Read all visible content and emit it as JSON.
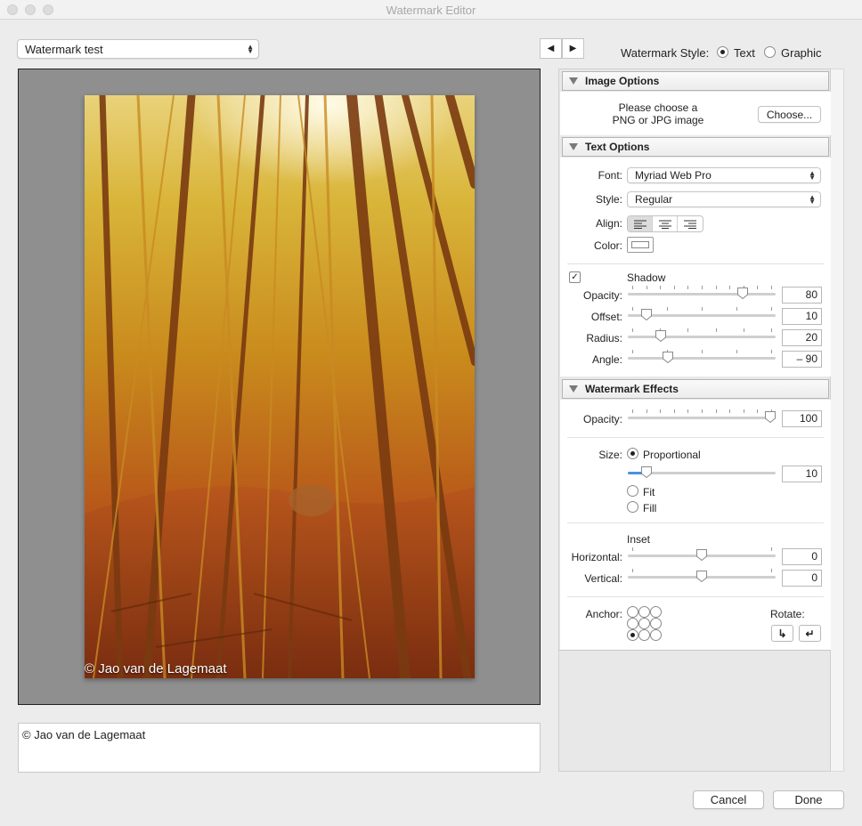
{
  "window": {
    "title": "Watermark Editor"
  },
  "preset": {
    "value": "Watermark test"
  },
  "nav": {
    "prev": "◀",
    "next": "▶"
  },
  "watermark_style": {
    "label": "Watermark Style:",
    "options": [
      "Text",
      "Graphic"
    ],
    "selected": "Text"
  },
  "preview": {
    "watermark_text": "© Jao van de Lagemaat"
  },
  "text_entry": {
    "value": "© Jao van de Lagemaat"
  },
  "image_options": {
    "header": "Image Options",
    "prompt_line1": "Please choose a",
    "prompt_line2": "PNG or JPG image",
    "choose_label": "Choose..."
  },
  "text_options": {
    "header": "Text Options",
    "font_label": "Font:",
    "font_value": "Myriad Web Pro",
    "style_label": "Style:",
    "style_value": "Regular",
    "align_label": "Align:",
    "align_selected": "left",
    "color_label": "Color:",
    "shadow": {
      "enabled": true,
      "label": "Shadow",
      "opacity_label": "Opacity:",
      "opacity": "80",
      "offset_label": "Offset:",
      "offset": "10",
      "radius_label": "Radius:",
      "radius": "20",
      "angle_label": "Angle:",
      "angle": "– 90"
    }
  },
  "watermark_effects": {
    "header": "Watermark Effects",
    "opacity_label": "Opacity:",
    "opacity": "100",
    "size_label": "Size:",
    "size_options": [
      "Proportional",
      "Fit",
      "Fill"
    ],
    "size_selected": "Proportional",
    "size_value": "10",
    "inset_label": "Inset",
    "horizontal_label": "Horizontal:",
    "horizontal": "0",
    "vertical_label": "Vertical:",
    "vertical": "0",
    "anchor_label": "Anchor:",
    "anchor_selected": "bottom-left",
    "rotate_label": "Rotate:"
  },
  "slider_levels": {
    "shadow_opacity": 0.8,
    "shadow_offset": 0.1,
    "shadow_radius": 0.2,
    "shadow_angle": 0.25,
    "effects_opacity": 1.0,
    "size": 0.1,
    "horizontal": 0.5,
    "vertical": 0.5
  },
  "footer": {
    "cancel": "Cancel",
    "done": "Done"
  }
}
